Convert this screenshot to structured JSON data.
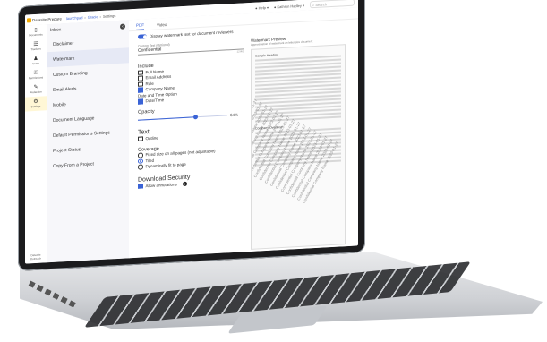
{
  "app": {
    "brand": "Datasite Prepare",
    "breadcrumbs": [
      "launchpad",
      "Gracie",
      "Settings"
    ],
    "help_label": "Help",
    "user_name": "Kathryn Hadley",
    "search_placeholder": "Search"
  },
  "icon_rail": {
    "items": [
      {
        "icon": "document-icon",
        "label": "Documents",
        "active": false
      },
      {
        "icon": "list-icon",
        "label": "Trackers",
        "active": false
      },
      {
        "icon": "users-icon",
        "label": "Users",
        "active": false
      },
      {
        "icon": "permissions-icon",
        "label": "Permissions",
        "active": false
      },
      {
        "icon": "redaction-icon",
        "label": "Redaction",
        "active": false
      },
      {
        "icon": "gear-icon",
        "label": "Settings",
        "active": true
      }
    ],
    "footer": "Datasite Outreach"
  },
  "settings_nav": {
    "header": "Inbox",
    "items": [
      {
        "label": "Disclaimer",
        "active": false
      },
      {
        "label": "Watermark",
        "active": true
      },
      {
        "label": "Custom Branding",
        "active": false
      },
      {
        "label": "Email Alerts",
        "active": false
      },
      {
        "label": "Mobile",
        "active": false
      },
      {
        "label": "Document Language",
        "active": false
      },
      {
        "label": "Default Permissions Settings",
        "active": false
      },
      {
        "label": "Project Status",
        "active": false
      },
      {
        "label": "Copy From a Project",
        "active": false
      }
    ]
  },
  "main": {
    "tabs": [
      {
        "label": "PDF",
        "active": true
      },
      {
        "label": "Video",
        "active": false
      }
    ],
    "display_toggle_label": "Display watermark text for document reviewers",
    "display_toggle_on": true,
    "custom_text_label": "Custom Text (Optional)",
    "custom_text_value": "Confidential",
    "custom_text_count": "12/40",
    "include_heading": "Include",
    "include_options": [
      {
        "label": "Full Name",
        "checked": false
      },
      {
        "label": "Email Address",
        "checked": false
      },
      {
        "label": "Role",
        "checked": false
      },
      {
        "label": "Company Name",
        "checked": true
      },
      {
        "label": "Date and Time Option",
        "checked": null
      },
      {
        "label": "Date/Time",
        "checked": true
      }
    ],
    "opacity_label": "Opacity",
    "opacity_value": "64%",
    "opacity_fraction": 0.64,
    "text_heading": "Text",
    "outline_label": "Outline",
    "outline_checked": false,
    "coverage_label": "Coverage",
    "coverage_options": [
      {
        "label": "Fixed size on all pages (not adjustable)",
        "selected": false
      },
      {
        "label": "Tiled",
        "selected": true
      },
      {
        "label": "Dynamically fit to page",
        "selected": false
      }
    ],
    "download_heading": "Download Security",
    "allow_annotations_label": "Allow annotations",
    "allow_annotations_checked": true
  },
  "preview": {
    "title": "Watermark Preview",
    "subtitle": "Approximation of watermark on letter size document",
    "doc_heading_1": "Sample Heading",
    "doc_heading_2": "Company Overview",
    "watermark_text": "Confidential Company Name 2023-01-27"
  },
  "colors": {
    "accent": "#3a63d6",
    "brand": "#f2a900",
    "active_rail": "#fff7d6"
  }
}
